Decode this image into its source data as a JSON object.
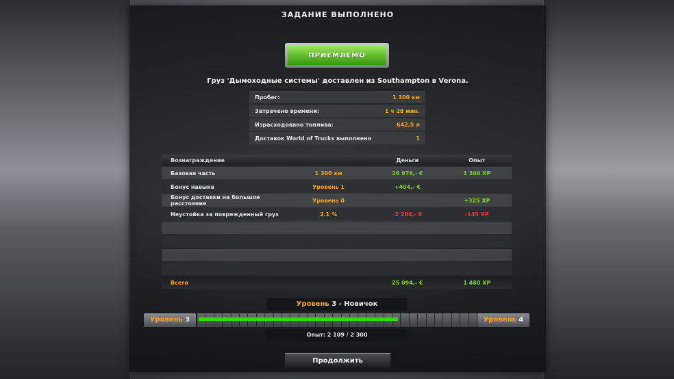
{
  "title": "ЗАДАНИЕ ВЫПОЛНЕНО",
  "accept_label": "ПРИЕМЛЕМО",
  "cargo_line": "Груз 'Дымоходные системы' доставлен из Southampton в Verona.",
  "stats": [
    {
      "label": "Пробег:",
      "value": "1 300 км"
    },
    {
      "label": "Затрачено времени:",
      "value": "1 ч 28 мин."
    },
    {
      "label": "Израсходовано топлива:",
      "value": "642,5 л"
    },
    {
      "label": "Доставок World of Trucks выполнено",
      "value": "1"
    }
  ],
  "rewards": {
    "headers": {
      "reward": "Вознаграждение",
      "money": "Деньги",
      "xp": "Опыт"
    },
    "rows": [
      {
        "name": "Базовая часть",
        "detail": "1 300 км",
        "money": "26 976,- €",
        "xp": "1 300 XP"
      },
      {
        "name": "Бонус навыка",
        "detail": "Уровень 1",
        "money": "+404,- €",
        "xp": ""
      },
      {
        "name": "Бонус доставки на большое расстояние",
        "detail": "Уровень 0",
        "money": "",
        "xp": "+325 XP"
      },
      {
        "name": "Неустойка за поврежденный груз",
        "detail": "2.1 %",
        "money": "-2 286,- €",
        "xp": "-145 XP"
      }
    ],
    "total": {
      "label": "Всего",
      "money": "25 094,- €",
      "xp": "1 480 XP"
    }
  },
  "level": {
    "title_level": "Уровень",
    "title_num": "3",
    "title_rank": "- Новичок",
    "current_label": "Уровень",
    "current_num": "3",
    "next_label": "Уровень",
    "next_num": "4",
    "progress_fraction": 0.72,
    "segments": 33
  },
  "xp_text": "Опыт: 2 109 / 2 300",
  "continue_label": "Продолжить"
}
